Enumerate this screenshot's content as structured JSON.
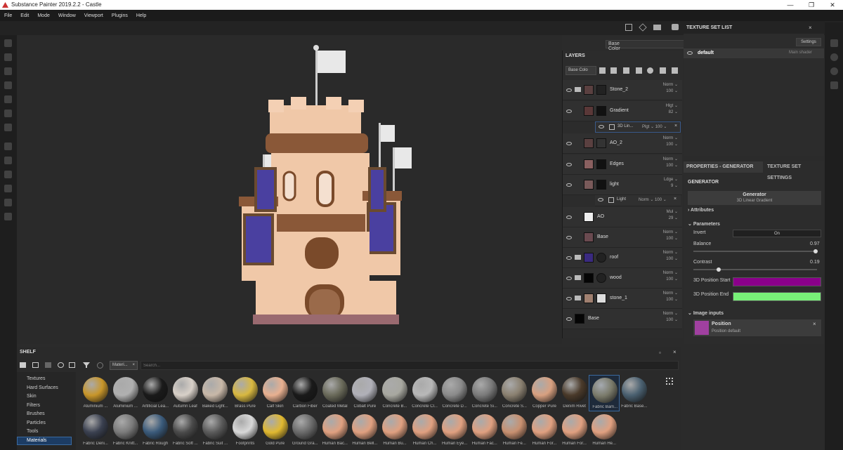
{
  "window": {
    "title": "Substance Painter 2019.2.2 - Castle",
    "min": "—",
    "max": "❐",
    "close": "✕"
  },
  "menu": [
    "File",
    "Edit",
    "Mode",
    "Window",
    "Viewport",
    "Plugins",
    "Help"
  ],
  "viewport": {
    "channel": "Base Color"
  },
  "layers": {
    "title": "LAYERS",
    "channel": "Base Colo",
    "items": [
      {
        "name": "Stone_2",
        "blend": "Norm",
        "opacity": "100",
        "thumb": "#5a4040"
      },
      {
        "name": "Gradient",
        "blend": "Hlgt",
        "opacity": "82",
        "thumb": "#5a3838"
      },
      {
        "name": "3D Lin...",
        "blend": "Plgt",
        "opacity": "100",
        "thumb": "#333"
      },
      {
        "name": "AO_2",
        "blend": "Norm",
        "opacity": "100",
        "thumb": "#5a4040"
      },
      {
        "name": "Edges",
        "blend": "Norm",
        "opacity": "100",
        "thumb": "#8a6060"
      },
      {
        "name": "light",
        "blend": "Ldge",
        "opacity": "9",
        "thumb": "#7a5a5a"
      },
      {
        "name": "Light",
        "blend": "Norm",
        "opacity": "100",
        "thumb": "#333"
      },
      {
        "name": "AO",
        "blend": "Mul",
        "opacity": "29",
        "thumb": "#eee"
      },
      {
        "name": "Base",
        "blend": "Norm",
        "opacity": "100",
        "thumb": "#6a4a50"
      },
      {
        "name": "roof",
        "blend": "Norm",
        "opacity": "100",
        "thumb": "#3a2a80"
      },
      {
        "name": "wood",
        "blend": "Norm",
        "opacity": "100",
        "thumb": "#050505"
      },
      {
        "name": "stone_1",
        "blend": "Norm",
        "opacity": "100",
        "thumb": "#a08070"
      },
      {
        "name": "Base",
        "blend": "Norm",
        "opacity": "100",
        "thumb": "#050505"
      }
    ]
  },
  "texture_set_list": {
    "title": "TEXTURE SET LIST",
    "settings": "Settings",
    "item": "default",
    "shader": "Main shader"
  },
  "properties": {
    "tab1": "PROPERTIES - GENERATOR",
    "tab2": "TEXTURE SET SETTINGS",
    "section": "GENERATOR",
    "generator": "Generator",
    "generator_value": "3D Linear Gradient",
    "attributes": "Attributes",
    "parameters": "Parameters",
    "invert_label": "Invert",
    "invert_value": "On",
    "balance_label": "Balance",
    "balance_value": "0.97",
    "contrast_label": "Contrast",
    "contrast_value": "0.19",
    "pos_start": "3D Position Start",
    "pos_end": "3D Position End",
    "start_color": "#8a008a",
    "end_color": "#78f078",
    "image_inputs": "Image inputs",
    "input_name": "Position",
    "input_value": "Position default"
  },
  "shelf": {
    "title": "SHELF",
    "filter": "Materi...",
    "search_placeholder": "Search...",
    "categories": [
      "Textures",
      "Hard Surfaces",
      "Skin",
      "Filters",
      "Brushes",
      "Particles",
      "Tools",
      "Materials"
    ],
    "materials_row1": [
      {
        "n": "Aluminium ...",
        "c": "#c8962a"
      },
      {
        "n": "Aluminium ...",
        "c": "#b0b0b0"
      },
      {
        "n": "Artificial Lea...",
        "c": "#1a1a1a"
      },
      {
        "n": "Autumn Leaf",
        "c": "#d8d0c8"
      },
      {
        "n": "Baked Light...",
        "c": "#c8b8a8"
      },
      {
        "n": "Brass Pure",
        "c": "#d8b840"
      },
      {
        "n": "Calf Skin",
        "c": "#e8b090"
      },
      {
        "n": "Carbon Fiber",
        "c": "#1a1a1a"
      },
      {
        "n": "Coated Metal",
        "c": "#6a6a5a"
      },
      {
        "n": "Cobalt Pure",
        "c": "#b0b0b8"
      },
      {
        "n": "Concrete B...",
        "c": "#a8a8a0"
      },
      {
        "n": "Concrete Cl...",
        "c": "#b8b8b8"
      },
      {
        "n": "Concrete D...",
        "c": "#8a8a8a"
      },
      {
        "n": "Concrete Si...",
        "c": "#7a7a7a"
      },
      {
        "n": "Concrete S...",
        "c": "#8a8070"
      },
      {
        "n": "Copper Pure",
        "c": "#d8a080"
      },
      {
        "n": "Denim Rivet",
        "c": "#4a3a2a"
      },
      {
        "n": "Fabric Bam...",
        "c": "#7a7a6a"
      },
      {
        "n": "Fabric Base...",
        "c": "#4a6070"
      }
    ],
    "materials_row2": [
      {
        "n": "Fabric Deni...",
        "c": "#3a4050"
      },
      {
        "n": "Fabric Knitt...",
        "c": "#7a7a7a"
      },
      {
        "n": "Fabric Rough",
        "c": "#3a5a7a"
      },
      {
        "n": "Fabric Soft ...",
        "c": "#4a4a4a"
      },
      {
        "n": "Fabric Suit ...",
        "c": "#5a5a5a"
      },
      {
        "n": "Footprints",
        "c": "#d8d8d8"
      },
      {
        "n": "Gold Pure",
        "c": "#e0b830"
      },
      {
        "n": "Ground Gra...",
        "c": "#6a6a6a"
      },
      {
        "n": "Human Bac...",
        "c": "#e0a080"
      },
      {
        "n": "Human Bell...",
        "c": "#e0a080"
      },
      {
        "n": "Human Bu...",
        "c": "#e0a080"
      },
      {
        "n": "Human Ch...",
        "c": "#e0a080"
      },
      {
        "n": "Human Eye...",
        "c": "#e0a080"
      },
      {
        "n": "Human Fac...",
        "c": "#e0a080"
      },
      {
        "n": "Human Fe...",
        "c": "#c89070"
      },
      {
        "n": "Human For...",
        "c": "#e0a080"
      },
      {
        "n": "Human For...",
        "c": "#e0a080"
      },
      {
        "n": "Human He...",
        "c": "#e0a080"
      }
    ]
  }
}
